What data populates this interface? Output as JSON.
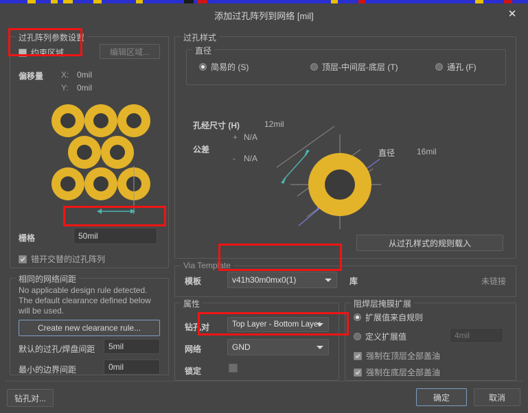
{
  "window": {
    "title": "添加过孔阵列到网络 [mil]",
    "close_label": "✕"
  },
  "left_panel": {
    "group_title": "过孔阵列参数设置",
    "constraint_area_checkbox": "约束区域",
    "edit_area_button": "编辑区域...",
    "offset_label": "偏移量",
    "offset_x_label": "X:",
    "offset_x_value": "0mil",
    "offset_y_label": "Y:",
    "offset_y_value": "0mil",
    "grid_label": "栅格",
    "grid_value": "50mil",
    "stagger_checkbox": "错开交替的过孔阵列"
  },
  "clearance": {
    "group_title": "相同的网络间距",
    "message": "No applicable design rule detected. The default clearance defined below will be used.",
    "create_rule_button": "Create new clearance rule...",
    "default_via_pad_label": "默认的过孔/焊盘间距",
    "default_via_pad_value": "5mil",
    "min_border_label": "最小的边界间距",
    "min_border_value": "0mil"
  },
  "via_style": {
    "group_title": "过孔样式",
    "diameter_group_title": "直径",
    "radios": [
      {
        "label": "简易的 (S)",
        "accel": "S",
        "selected": true
      },
      {
        "label": "顶层-中间层-底层 (T)",
        "accel": "T",
        "selected": false
      },
      {
        "label": "通孔 (F)",
        "accel": "F",
        "selected": false
      }
    ],
    "hole_size_label": "孔经尺寸 (H)",
    "hole_size_value": "12mil",
    "tolerance_label": "公差",
    "tolerance_plus_sign": "+",
    "tolerance_plus_value": "N/A",
    "tolerance_minus_sign": "-",
    "tolerance_minus_value": "N/A",
    "diameter_label": "直径",
    "diameter_value": "16mil",
    "load_from_rule_button": "从过孔样式的规则载入"
  },
  "via_template": {
    "group_title": "Via Template",
    "template_label": "模板",
    "template_value": "v41h30m0mx0(1)",
    "library_label": "库",
    "library_value": "未链接"
  },
  "properties": {
    "group_title": "属性",
    "drill_pair_label": "钻孔对",
    "drill_pair_value": "Top Layer - Bottom Layer",
    "net_label": "网络",
    "net_value": "GND",
    "lock_label": "锁定"
  },
  "solder_mask": {
    "group_title": "阻焊层掩膜扩展",
    "radio_from_rule": "扩展值来自规则",
    "radio_define": "定义扩展值",
    "expansion_value": "4mil",
    "force_top_checkbox": "强制在顶层全部盖油",
    "force_bottom_checkbox": "强制在底层全部盖油"
  },
  "footer": {
    "drill_pair_button": "钻孔对...",
    "ok_button": "确定",
    "cancel_button": "取消"
  },
  "colors": {
    "via_gold": "#e3b32a",
    "annotation_red": "#f01414",
    "dialog_bg": "#454545",
    "panel_bg": "#3b3b3b"
  }
}
